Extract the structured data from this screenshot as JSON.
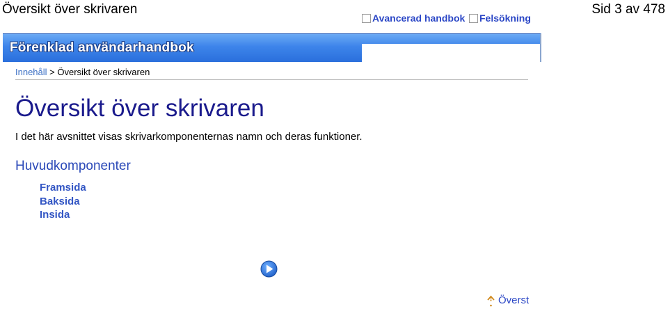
{
  "header": {
    "doc_title": "Översikt över skrivaren",
    "page_number": "Sid 3 av 478"
  },
  "banner": {
    "title": "Förenklad användarhandbok",
    "links": {
      "advanced": "Avancerad handbok",
      "troubleshooting": "Felsökning"
    }
  },
  "breadcrumb": {
    "home": "Innehåll",
    "separator": ">",
    "current": "Översikt över skrivaren"
  },
  "main": {
    "title": "Översikt över skrivaren",
    "intro": "I det här avsnittet visas skrivarkomponenternas namn och deras funktioner.",
    "section_heading": "Huvudkomponenter",
    "components": [
      "Framsida",
      "Baksida",
      "Insida"
    ]
  },
  "footer": {
    "top_link": "Överst"
  },
  "icons": {
    "next": "next-arrow-icon",
    "top": "up-arrow-icon",
    "box": "box-icon"
  },
  "colors": {
    "banner_blue": "#3d84ea",
    "title_navy": "#1a1a8c",
    "link_blue": "#2b47c6"
  }
}
